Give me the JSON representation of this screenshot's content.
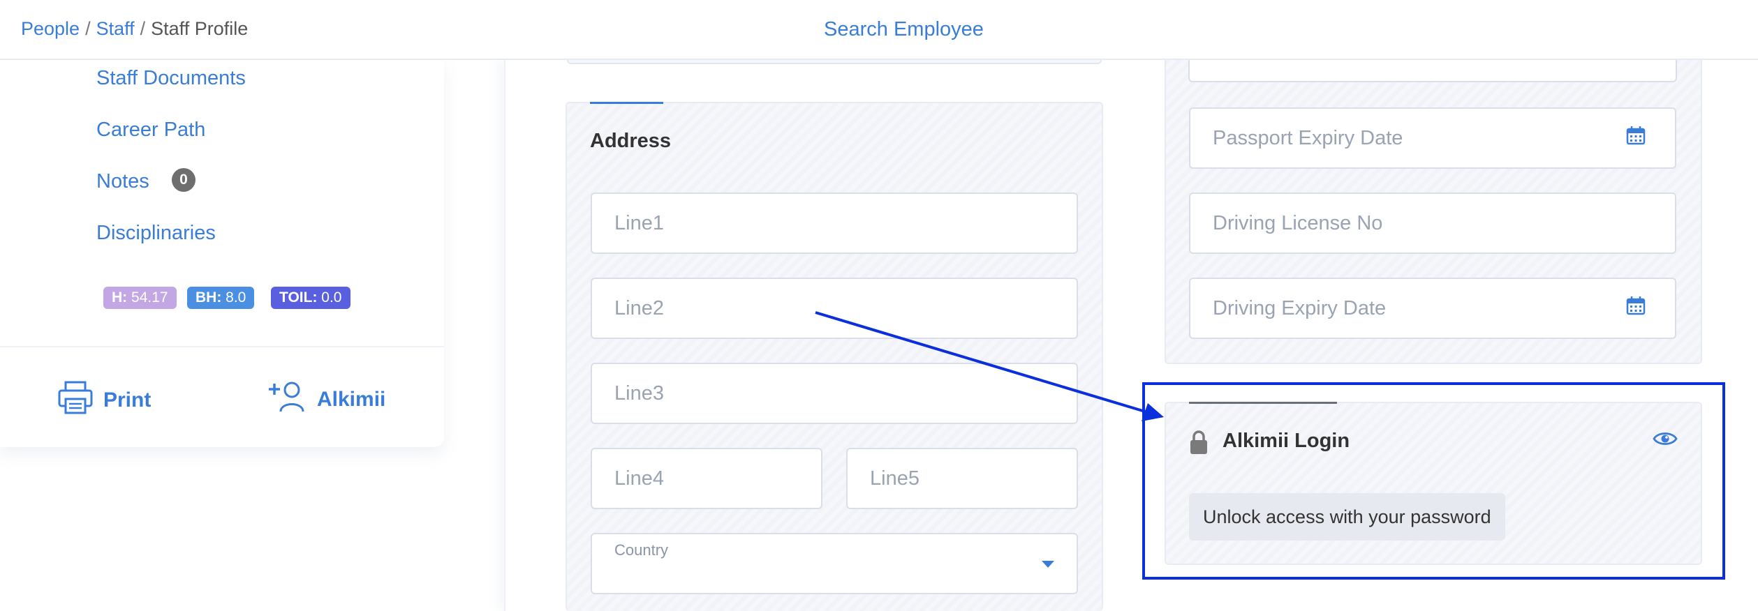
{
  "breadcrumb": {
    "items": [
      "People",
      "Staff",
      "Staff Profile"
    ],
    "separator": "/"
  },
  "header": {
    "search_label": "Search Employee"
  },
  "sidebar": {
    "links": [
      "Staff Documents",
      "Career Path",
      "Notes",
      "Disciplinaries"
    ],
    "notes_count": "0",
    "pills": [
      {
        "key": "H:",
        "value": "54.17",
        "color": "#c3a6e4"
      },
      {
        "key": "BH:",
        "value": "8.0",
        "color": "#4b8fe3"
      },
      {
        "key": "TOIL:",
        "value": "0.0",
        "color": "#5a5fe0"
      }
    ],
    "actions": {
      "print": {
        "label": "Print",
        "icon": "printer-icon"
      },
      "alkimii": {
        "label": "Alkimii",
        "icon": "add-user-icon"
      }
    }
  },
  "address": {
    "title": "Address",
    "line1_placeholder": "Line1",
    "line2_placeholder": "Line2",
    "line3_placeholder": "Line3",
    "line4_placeholder": "Line4",
    "line5_placeholder": "Line5",
    "country_label": "Country"
  },
  "documents": {
    "passport_expiry_placeholder": "Passport Expiry Date",
    "driving_license_placeholder": "Driving License No",
    "driving_expiry_placeholder": "Driving Expiry Date"
  },
  "login": {
    "title": "Alkimii Login",
    "unlock_text": "Unlock access with your password"
  },
  "colors": {
    "accent": "#3a7dd8",
    "highlight": "#0a2fdc"
  }
}
